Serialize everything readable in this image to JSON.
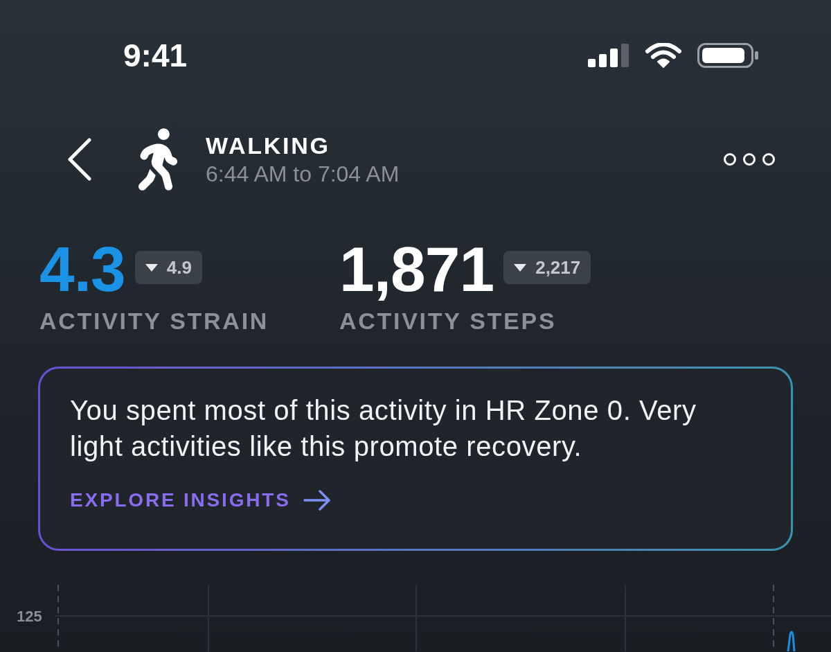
{
  "status_bar": {
    "time": "9:41"
  },
  "header": {
    "title": "WALKING",
    "subtitle": "6:44 AM to 7:04 AM"
  },
  "metrics": [
    {
      "value": "4.3",
      "comparison": "4.9",
      "label": "ACTIVITY STRAIN",
      "color": "#1a93e6"
    },
    {
      "value": "1,871",
      "comparison": "2,217",
      "label": "ACTIVITY STEPS",
      "color": "#ffffff"
    }
  ],
  "insight": {
    "text": "You spent most of this activity in HR Zone 0. Very light activities like this promote recovery.",
    "link": "EXPLORE INSIGHTS"
  },
  "chart": {
    "axis_label": "125"
  }
}
